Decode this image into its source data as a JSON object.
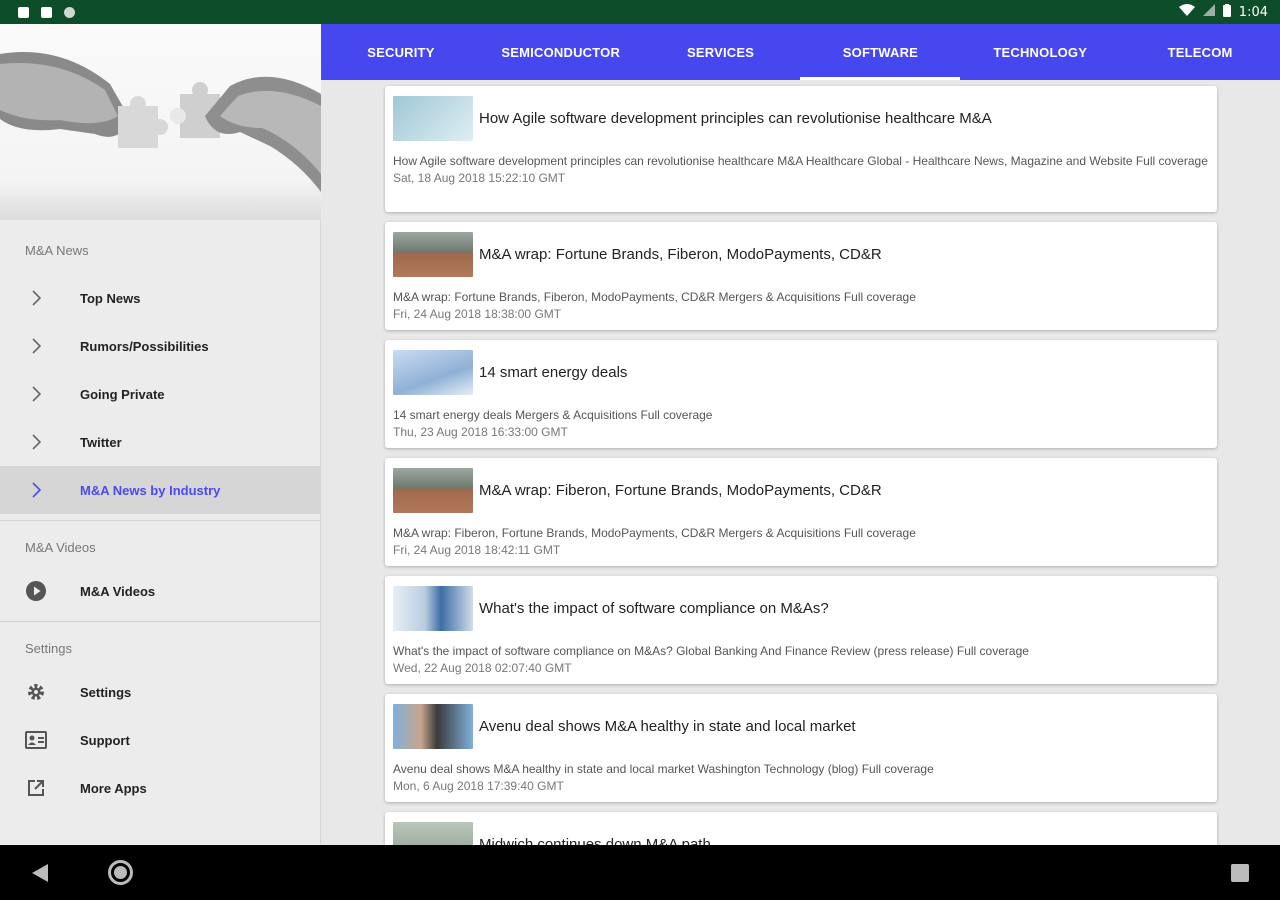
{
  "status": {
    "time": "1:04"
  },
  "drawer": {
    "sections": [
      {
        "label": "M&A News",
        "items": [
          {
            "label": "Top News",
            "icon": "chevron-right-icon"
          },
          {
            "label": "Rumors/Possibilities",
            "icon": "chevron-right-icon"
          },
          {
            "label": "Going Private",
            "icon": "chevron-right-icon"
          },
          {
            "label": "Twitter",
            "icon": "chevron-right-icon"
          },
          {
            "label": "M&A News by Industry",
            "icon": "chevron-right-icon",
            "active": true
          }
        ]
      },
      {
        "label": "M&A Videos",
        "items": [
          {
            "label": "M&A Videos",
            "icon": "play-circle-icon"
          }
        ]
      },
      {
        "label": "Settings",
        "items": [
          {
            "label": "Settings",
            "icon": "gear-icon"
          },
          {
            "label": "Support",
            "icon": "support-icon"
          },
          {
            "label": "More Apps",
            "icon": "external-link-icon"
          }
        ]
      }
    ]
  },
  "tabs": [
    {
      "label": "SECURITY"
    },
    {
      "label": "SEMICONDUCTOR"
    },
    {
      "label": "SERVICES"
    },
    {
      "label": "SOFTWARE",
      "active": true
    },
    {
      "label": "TECHNOLOGY"
    },
    {
      "label": "TELECOM"
    }
  ],
  "articles": [
    {
      "title": "How Agile software development principles can revolutionise healthcare M&A",
      "desc": "How Agile software development principles can revolutionise healthcare M&A  Healthcare Global - Healthcare News, Magazine and Website  Full coverage",
      "date": "Sat, 18 Aug 2018 15:22:10 GMT",
      "thumb_color": "#9fc7d6"
    },
    {
      "title": "M&A wrap: Fortune Brands, Fiberon, ModoPayments, CD&R",
      "desc": "M&A wrap: Fortune Brands, Fiberon, ModoPayments, CD&R  Mergers & Acquisitions  Full coverage",
      "date": "Fri, 24 Aug 2018 18:38:00 GMT",
      "thumb_color": "#8b6a55"
    },
    {
      "title": "14 smart energy deals",
      "desc": "14 smart energy deals  Mergers & Acquisitions  Full coverage",
      "date": "Thu, 23 Aug 2018 16:33:00 GMT",
      "thumb_color": "#a9c4e0"
    },
    {
      "title": "M&A wrap: Fiberon, Fortune Brands, ModoPayments, CD&R",
      "desc": "M&A wrap: Fiberon, Fortune Brands, ModoPayments, CD&R  Mergers & Acquisitions  Full coverage",
      "date": "Fri, 24 Aug 2018 18:42:11 GMT",
      "thumb_color": "#8b6a55"
    },
    {
      "title": "What's the impact of software compliance on M&As?",
      "desc": "What's the impact of software compliance on M&As?  Global Banking And Finance Review (press release)  Full coverage",
      "date": "Wed, 22 Aug 2018 02:07:40 GMT",
      "thumb_color": "#7fa8c9"
    },
    {
      "title": "Avenu deal shows M&A healthy in state and local market",
      "desc": "Avenu deal shows M&A healthy in state and local market  Washington Technology (blog)  Full coverage",
      "date": "Mon, 6 Aug 2018 17:39:40 GMT",
      "thumb_color": "#6f9fc8"
    },
    {
      "title": "Midwich continues down M&A path",
      "desc": "",
      "date": "",
      "thumb_color": "#aab8ab"
    }
  ]
}
